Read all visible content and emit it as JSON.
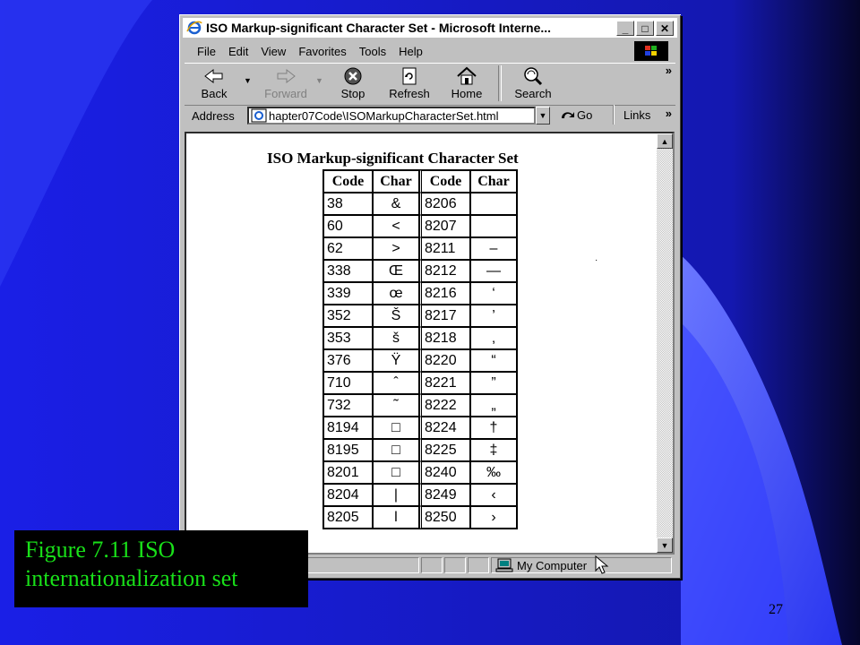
{
  "window": {
    "title": "ISO Markup-significant Character Set - Microsoft Interne...",
    "controls": [
      "_",
      "□",
      "✕"
    ]
  },
  "menu": [
    "File",
    "Edit",
    "View",
    "Favorites",
    "Tools",
    "Help"
  ],
  "toolbar": {
    "back": "Back",
    "forward": "Forward",
    "stop": "Stop",
    "refresh": "Refresh",
    "home": "Home",
    "search": "Search",
    "more": "»"
  },
  "address": {
    "label": "Address",
    "value": "hapter07Code\\ISOMarkupCharacterSet.html",
    "go": "Go",
    "links": "Links",
    "more": "»"
  },
  "page": {
    "heading": "ISO Markup-significant Character Set",
    "columns": [
      "Code",
      "Char",
      "Code",
      "Char"
    ],
    "rows": [
      [
        "38",
        "&",
        "8206",
        ""
      ],
      [
        "60",
        "<",
        "8207",
        ""
      ],
      [
        "62",
        ">",
        "8211",
        "–"
      ],
      [
        "338",
        "Œ",
        "8212",
        "—"
      ],
      [
        "339",
        "œ",
        "8216",
        "‘"
      ],
      [
        "352",
        "Š",
        "8217",
        "’"
      ],
      [
        "353",
        "š",
        "8218",
        "‚"
      ],
      [
        "376",
        "Ÿ",
        "8220",
        "“"
      ],
      [
        "710",
        "ˆ",
        "8221",
        "”"
      ],
      [
        "732",
        "˜",
        "8222",
        "„"
      ],
      [
        "8194",
        "□",
        "8224",
        "†"
      ],
      [
        "8195",
        "□",
        "8225",
        "‡"
      ],
      [
        "8201",
        "□",
        "8240",
        "‰"
      ],
      [
        "8204",
        "|",
        "8249",
        "‹"
      ],
      [
        "8205",
        "ǀ",
        "8250",
        "›"
      ]
    ]
  },
  "status": {
    "zone": "My Computer"
  },
  "caption": {
    "line1": "Figure 7.11 ISO",
    "line2": "internationalization set"
  },
  "slide_number": "27",
  "colors": {
    "slide_bg": "#1d22e0",
    "caption_text": "#19e019",
    "caption_bg": "#000000"
  }
}
